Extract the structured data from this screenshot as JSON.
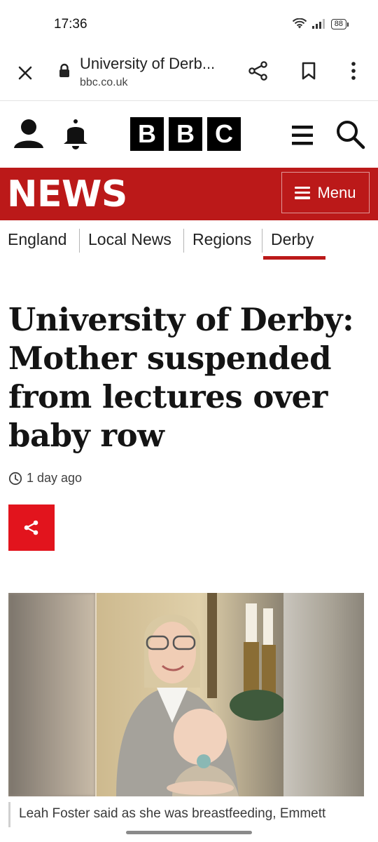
{
  "status_bar": {
    "time": "17:36",
    "battery_level": "88",
    "icons": [
      "wifi-icon",
      "signal-icon",
      "battery-icon"
    ]
  },
  "browser": {
    "title": "University of Derb...",
    "domain": "bbc.co.uk",
    "icons": [
      "close-icon",
      "lock-icon",
      "share-icon",
      "bookmark-icon",
      "more-vert-icon"
    ]
  },
  "bbc_header": {
    "logo_letters": [
      "B",
      "B",
      "C"
    ],
    "icons": [
      "account-icon",
      "bell-icon",
      "menu-icon",
      "search-icon"
    ]
  },
  "news_bar": {
    "logo": "NEWS",
    "menu_label": "Menu",
    "color": "#bb1919"
  },
  "sub_nav": {
    "items": [
      "England",
      "Local News",
      "Regions",
      "Derby"
    ],
    "active": "Derby"
  },
  "article": {
    "headline": "University of Derby: Mother suspended from lectures over baby row",
    "timestamp": "1 day ago",
    "share_color": "#e2141d",
    "caption": "Leah Foster said as she was breastfeeding, Emmett"
  }
}
